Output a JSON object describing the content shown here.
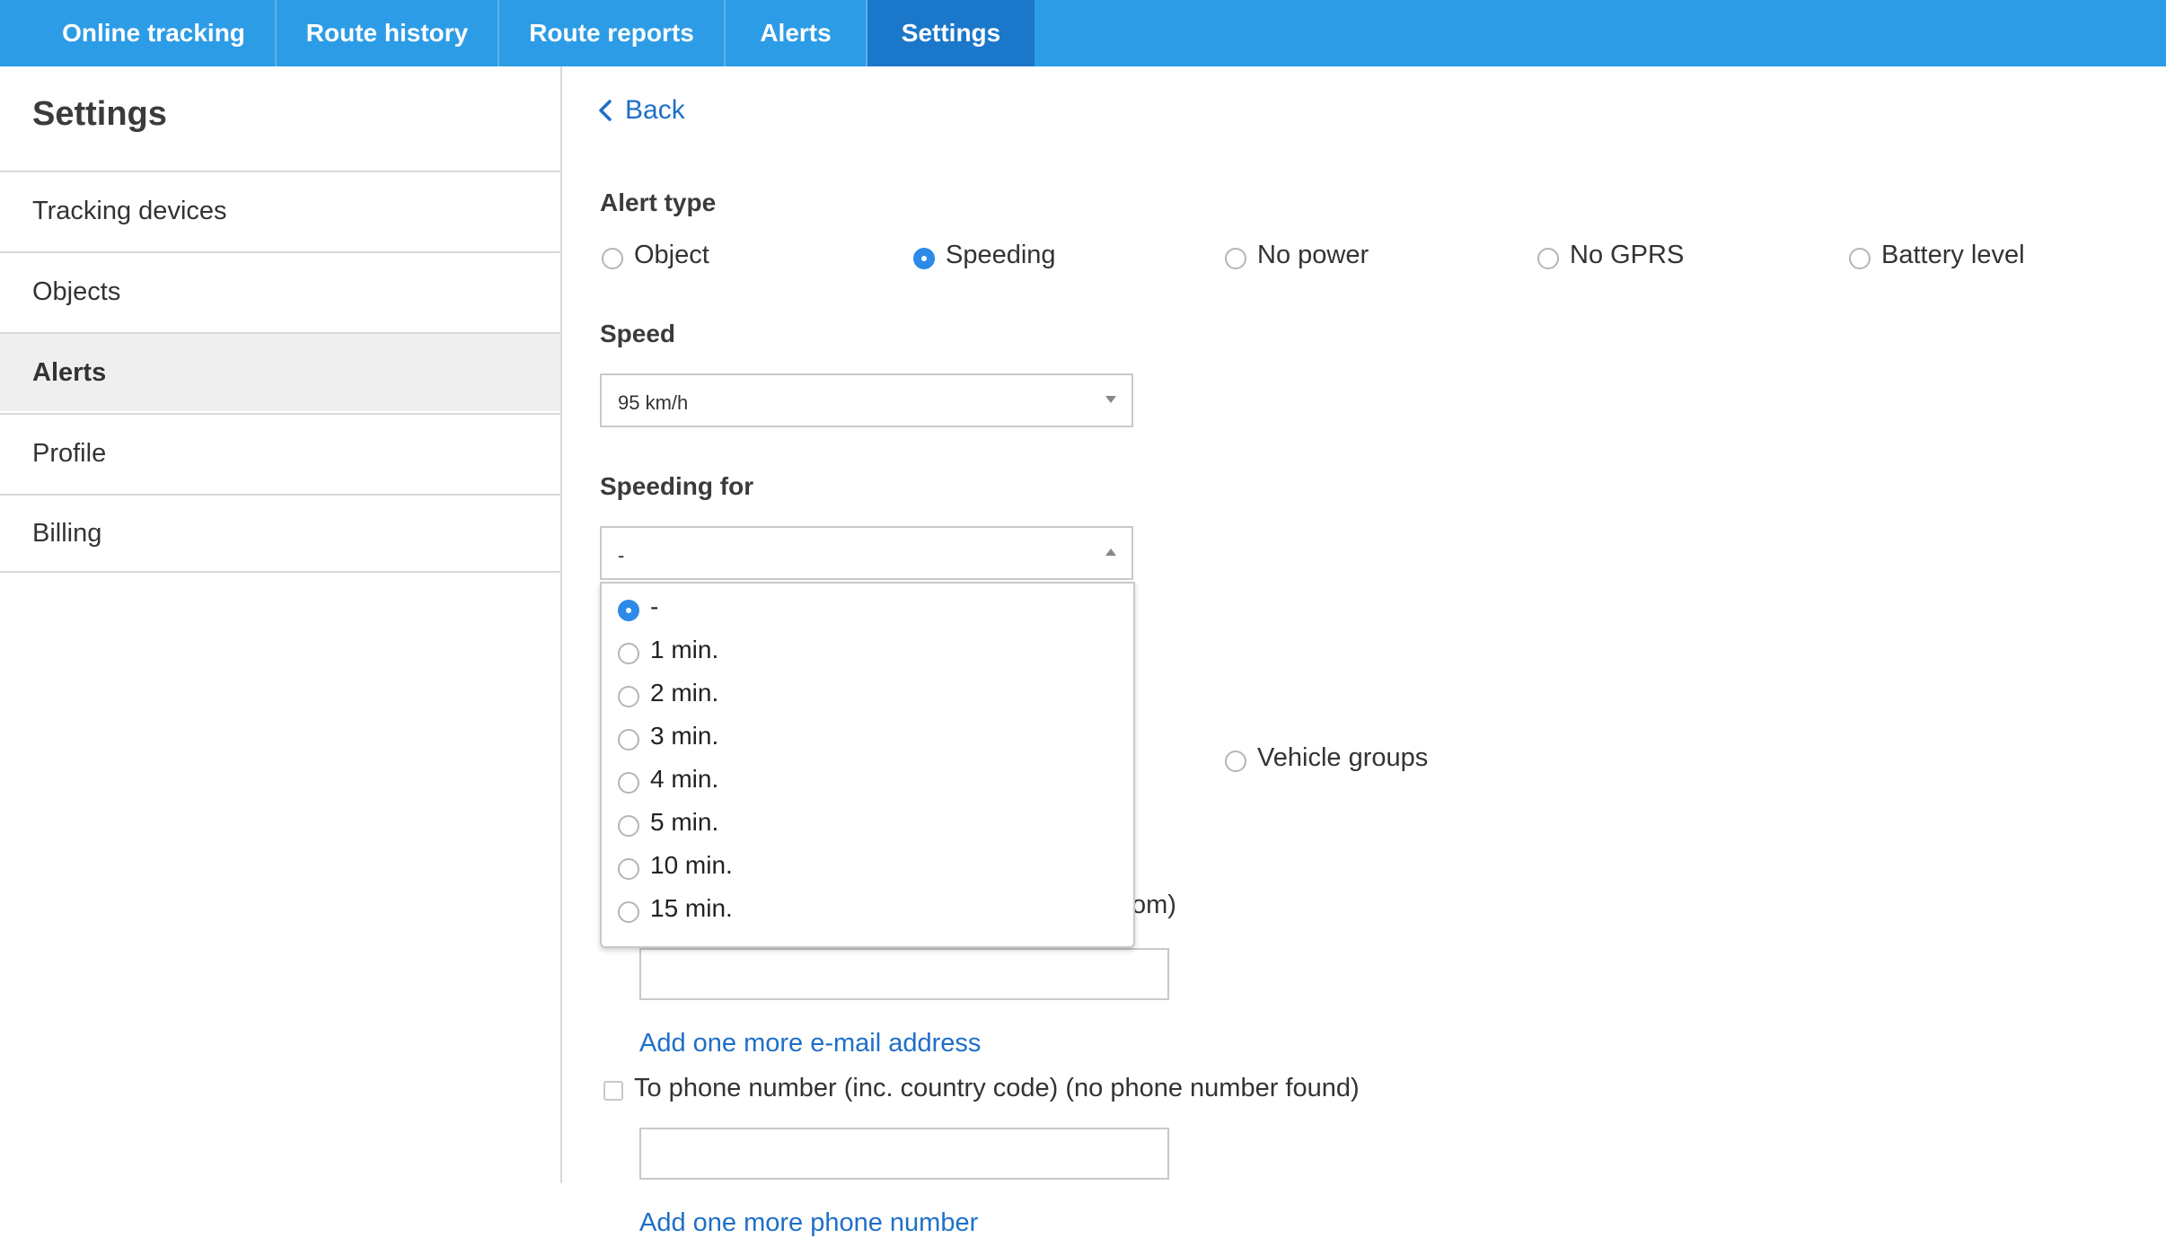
{
  "topnav": {
    "tabs": [
      {
        "label": "Online tracking"
      },
      {
        "label": "Route history"
      },
      {
        "label": "Route reports"
      },
      {
        "label": "Alerts"
      },
      {
        "label": "Settings"
      }
    ],
    "active": "Settings",
    "color": "#2d9ce6",
    "active_color": "#1b77c9"
  },
  "sidebar": {
    "title": "Settings",
    "items": [
      {
        "label": "Tracking devices"
      },
      {
        "label": "Objects"
      },
      {
        "label": "Alerts"
      },
      {
        "label": "Profile"
      },
      {
        "label": "Billing"
      }
    ],
    "active": "Alerts"
  },
  "main": {
    "back_label": "Back",
    "alert_type": {
      "label": "Alert type",
      "options": [
        "Object",
        "Speeding",
        "No power",
        "No GPRS",
        "Battery level"
      ],
      "selected": "Speeding"
    },
    "speed": {
      "label": "Speed",
      "value": "95 km/h"
    },
    "speeding_for": {
      "label": "Speeding for",
      "value": "-",
      "options": [
        "-",
        "1 min.",
        "2 min.",
        "3 min.",
        "4 min.",
        "5 min.",
        "10 min.",
        "15 min."
      ],
      "selected": "-"
    },
    "vehicle_groups_label": "Vehicle groups",
    "partial_email_label": "om)",
    "add_email_label": "Add one more e-mail address",
    "phone_checkbox_label": "To phone number (inc. country code) (no phone number found)",
    "add_phone_label": "Add one more phone number",
    "link_color": "#1e6fc8"
  }
}
